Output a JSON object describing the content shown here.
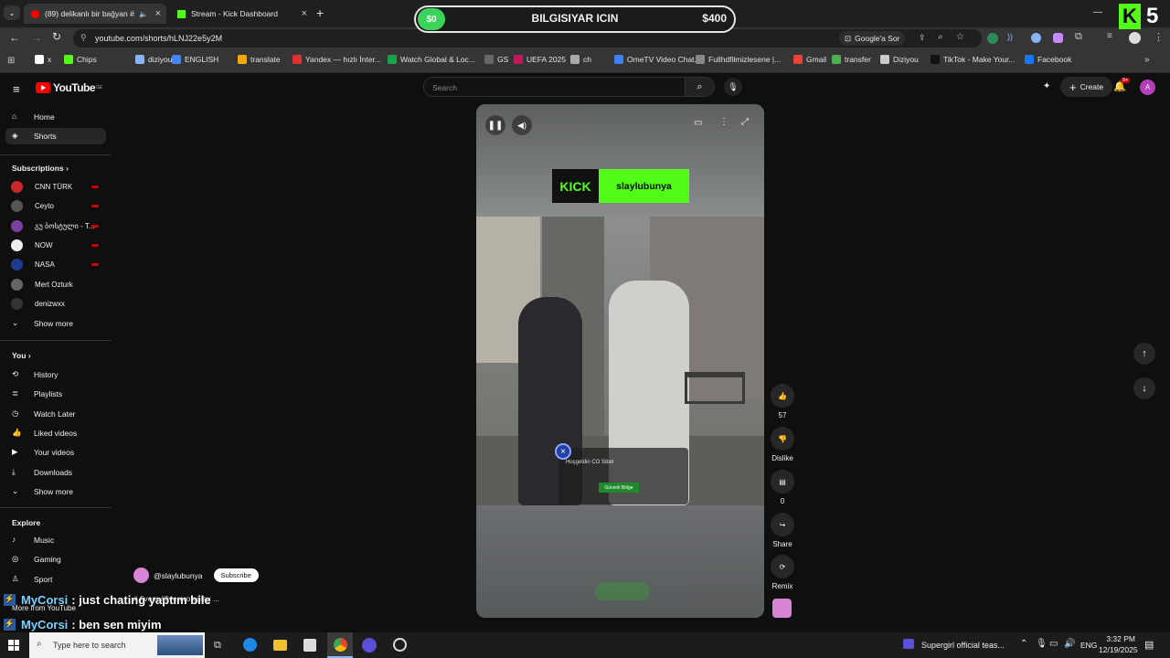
{
  "browser": {
    "tabs": [
      {
        "label": "(89) delikanlı bir bağyan #"
      },
      {
        "label": "Stream - Kick Dashboard"
      }
    ],
    "url": "youtube.com/shorts/hLNJ22e5y2M",
    "google_btn": "Google'a Sor",
    "bookmarks": [
      "x",
      "Chips",
      "diziyou",
      "ENGLISH",
      "translate",
      "Yandex — hızlı İnter...",
      "Watch Global & Loc...",
      "GS",
      "UEFA 2025",
      "ch",
      "OmeTV Video Chat...",
      "Fullhdfilmizlesene |...",
      "Gmail",
      "transfer",
      "Diziyou",
      "TikTok - Make Your...",
      "Facebook"
    ]
  },
  "overlay": {
    "left_amount": "$0",
    "title": "BILGISIYAR ICIN",
    "right_amount": "$400",
    "kick_number": "5",
    "kick_letter": "K"
  },
  "youtube": {
    "logo_text": "YouTube",
    "logo_sup": "GE",
    "search_placeholder": "Search",
    "create_label": "Create",
    "notif_count": "9+",
    "avatar_letter": "A",
    "nav": {
      "home": "Home",
      "shorts": "Shorts",
      "subscriptions": "Subscriptions",
      "channels": [
        "CNN TÜRK",
        "Ceyto",
        "გუ ბოსტული - T...",
        "NOW",
        "NASA",
        "Mert Ozturk",
        "denizwxx"
      ],
      "show_more": "Show more",
      "you": "You",
      "you_items": [
        "History",
        "Playlists",
        "Watch Later",
        "Liked videos",
        "Your videos",
        "Downloads"
      ],
      "explore": "Explore",
      "explore_items": [
        "Music",
        "Gaming",
        "Sport"
      ],
      "more_from": "More from YouTube"
    },
    "short": {
      "banner_kick": "KICK",
      "banner_name": "slaylubunya",
      "game_popup_name": "Hoşgeldin CO Sibel",
      "game_popup_btn": "Güvenli Bölge",
      "channel": "@slaylubunya",
      "subscribe": "Subscribe",
      "title": "# fivem #fivemroleplay ...",
      "like_count": "57",
      "dislike": "Dislike",
      "comments": "0",
      "share": "Share",
      "remix": "Remix"
    },
    "chat": [
      {
        "user": "MyCorsi",
        "msg": ": just chating yaptım bile"
      },
      {
        "user": "MyCorsi",
        "msg": ": ben sen miyim"
      }
    ]
  },
  "taskbar": {
    "search_placeholder": "Type here to search",
    "notification": "Supergirl official teas...",
    "lang": "ENG",
    "time": "3:32 PM",
    "date": "12/19/2025"
  }
}
